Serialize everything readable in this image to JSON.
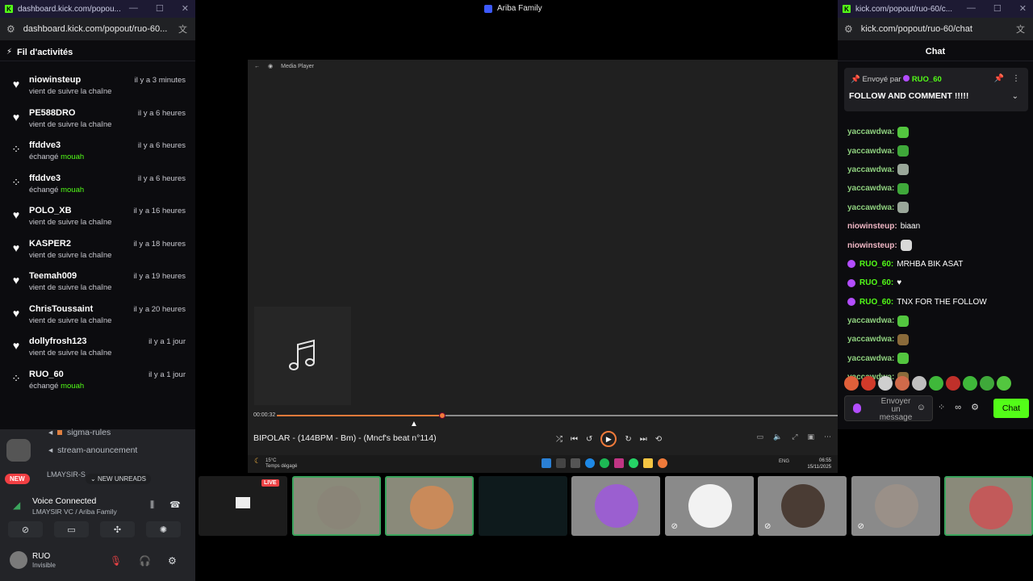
{
  "left_window": {
    "tab_title": "dashboard.kick.com/popou...",
    "url": "dashboard.kick.com/popout/ruo-60...",
    "panel_title": "Fil d'activités",
    "activities": [
      {
        "user": "niowinsteup",
        "time": "il y a 3 minutes",
        "text": "vient de suivre la chaîne",
        "highlight": "",
        "icon": "heart"
      },
      {
        "user": "PE588DRO",
        "time": "il y a 6 heures",
        "text": "vient de suivre la chaîne",
        "highlight": "",
        "icon": "heart"
      },
      {
        "user": "ffddve3",
        "time": "il y a 6 heures",
        "text": "échangé",
        "highlight": "mouah",
        "icon": "points"
      },
      {
        "user": "ffddve3",
        "time": "il y a 6 heures",
        "text": "échangé",
        "highlight": "mouah",
        "icon": "points"
      },
      {
        "user": "POLO_XB",
        "time": "il y a 16 heures",
        "text": "vient de suivre la chaîne",
        "highlight": "",
        "icon": "heart"
      },
      {
        "user": "KASPER2",
        "time": "il y a 18 heures",
        "text": "vient de suivre la chaîne",
        "highlight": "",
        "icon": "heart"
      },
      {
        "user": "Teemah009",
        "time": "il y a 19 heures",
        "text": "vient de suivre la chaîne",
        "highlight": "",
        "icon": "heart"
      },
      {
        "user": "ChrisToussaint",
        "time": "il y a 20 heures",
        "text": "vient de suivre la chaîne",
        "highlight": "",
        "icon": "heart"
      },
      {
        "user": "dollyfrosh123",
        "time": "il y a 1 jour",
        "text": "vient de suivre la chaîne",
        "highlight": "",
        "icon": "heart"
      },
      {
        "user": "RUO_60",
        "time": "il y a 1 jour",
        "text": "échangé",
        "highlight": "mouah",
        "icon": "points"
      }
    ]
  },
  "discord": {
    "channels": [
      "sigma-rules",
      "stream-anouncement"
    ],
    "partial_channel": "LMAYSIR-S",
    "new_label": "NEW",
    "unreads_label": "NEW UNREADS",
    "voice_status": "Voice Connected",
    "voice_server": "LMAYSIR VC / Ariba Family",
    "user_name": "RUO",
    "user_status": "Invisible"
  },
  "center": {
    "window_title": "Ariba Family"
  },
  "player": {
    "header": "Media Player",
    "elapsed": "00:00:32",
    "progress_percent": 29.5,
    "song_title": "BIPOLAR - (144BPM - Bm) - (Mncf's beat n°114)",
    "weather_temp": "15°C",
    "weather_text": "Temps dégagé",
    "clock_time": "06:55",
    "clock_date": "15/11/2025",
    "lang": "ENG"
  },
  "chat_window": {
    "tab_title": "kick.com/popout/ruo-60/c...",
    "url": "kick.com/popout/ruo-60/chat",
    "title": "Chat",
    "pinned_by_label": "Envoyé par",
    "pinned_by_user": "RUO_60",
    "pinned_message": "FOLLOW AND COMMENT !!!!!",
    "messages": [
      {
        "user": "yaccawdwa",
        "text": "",
        "color": "#8fd17f",
        "badge": false,
        "emote": "#53c63f"
      },
      {
        "user": "yaccawdwa",
        "text": "",
        "color": "#8fd17f",
        "badge": false,
        "emote": "#3fa83a"
      },
      {
        "user": "yaccawdwa",
        "text": "",
        "color": "#8fd17f",
        "badge": false,
        "emote": "#9aa79a"
      },
      {
        "user": "yaccawdwa",
        "text": "",
        "color": "#8fd17f",
        "badge": false,
        "emote": "#3fa83a"
      },
      {
        "user": "yaccawdwa",
        "text": "",
        "color": "#8fd17f",
        "badge": false,
        "emote": "#9aa79a"
      },
      {
        "user": "niowinsteup",
        "text": "biaan",
        "color": "#f2b8c6",
        "badge": false,
        "emote": ""
      },
      {
        "user": "niowinsteup",
        "text": "",
        "color": "#f2b8c6",
        "badge": false,
        "emote": "#d8d8d8"
      },
      {
        "user": "RUO_60",
        "text": "MRHBA BIK ASAT",
        "color": "#53fc18",
        "badge": true,
        "emote": ""
      },
      {
        "user": "RUO_60",
        "text": "♥",
        "color": "#53fc18",
        "badge": true,
        "emote": ""
      },
      {
        "user": "RUO_60",
        "text": "TNX FOR THE FOLLOW",
        "color": "#53fc18",
        "badge": true,
        "emote": ""
      },
      {
        "user": "yaccawdwa",
        "text": "",
        "color": "#8fd17f",
        "badge": false,
        "emote": "#53c63f"
      },
      {
        "user": "yaccawdwa",
        "text": "",
        "color": "#8fd17f",
        "badge": false,
        "emote": "#8a6a3a"
      },
      {
        "user": "yaccawdwa",
        "text": "",
        "color": "#8fd17f",
        "badge": false,
        "emote": "#53c63f"
      },
      {
        "user": "yaccawdwa",
        "text": "",
        "color": "#8fd17f",
        "badge": false,
        "emote": "#8a6a3a"
      }
    ],
    "emote_bar": [
      "#e0603a",
      "#d03a2a",
      "#cfcfcf",
      "#d06a4a",
      "#bfbfbf",
      "#3fb83a",
      "#c0302a",
      "#3fb83a",
      "#3fa83a",
      "#53c63f"
    ],
    "input_placeholder": "Envoyer un message",
    "send_label": "Chat"
  },
  "participants": {
    "live_label": "LIVE",
    "tiles": [
      {
        "kind": "screen",
        "color": "#1c1c1c",
        "active": false,
        "muted": false
      },
      {
        "kind": "avatar",
        "color": "#8a8578",
        "active": true,
        "muted": false
      },
      {
        "kind": "avatar",
        "color": "#c98a5a",
        "active": true,
        "muted": false
      },
      {
        "kind": "dark",
        "color": "#0e1a1c",
        "active": false,
        "muted": false
      },
      {
        "kind": "avatar",
        "color": "#9b5fd0",
        "active": false,
        "muted": false
      },
      {
        "kind": "avatar",
        "color": "#f2f2f2",
        "active": false,
        "muted": true
      },
      {
        "kind": "avatar",
        "color": "#4a3c34",
        "active": false,
        "muted": true
      },
      {
        "kind": "avatar",
        "color": "#9a9088",
        "active": false,
        "muted": true
      },
      {
        "kind": "avatar",
        "color": "#c25a5a",
        "active": true,
        "muted": false
      }
    ]
  },
  "colors": {
    "kick_green": "#53fc18",
    "player_accent": "#f07a3a",
    "discord_red": "#f23f43"
  }
}
